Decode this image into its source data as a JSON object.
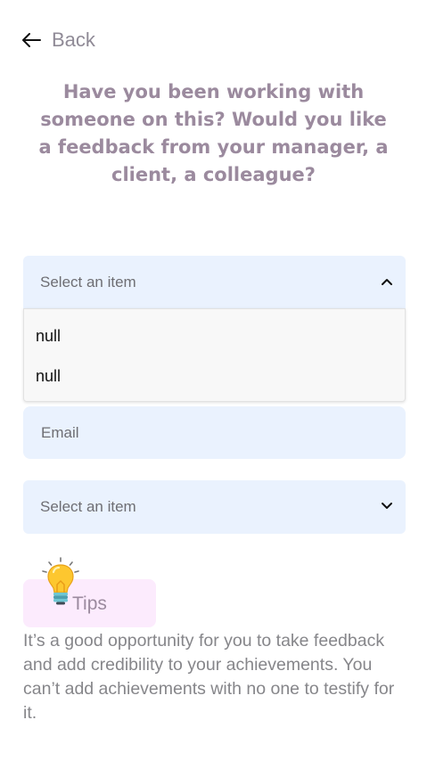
{
  "nav": {
    "back_label": "Back"
  },
  "question": "Have you been working with someone on this? Would you like a feedback from your manager, a client, a colleague?",
  "dropdown_1": {
    "placeholder": "Select an item",
    "state": "expanded",
    "options": [
      "null",
      "null"
    ]
  },
  "email": {
    "placeholder": "Email",
    "value": ""
  },
  "dropdown_2": {
    "placeholder": "Select an item",
    "state": "collapsed"
  },
  "tips": {
    "label": "Tips",
    "icon": "lightbulb-icon",
    "text": "It’s a good opportunity for you to take feedback and add credibility to your achievements. You can’t add achievements with no one to testify for it."
  },
  "colors": {
    "heading": "#9b8a9e",
    "field_background": "#eaf2fe",
    "tips_background": "#fcebfd",
    "body_text": "#86868a"
  }
}
